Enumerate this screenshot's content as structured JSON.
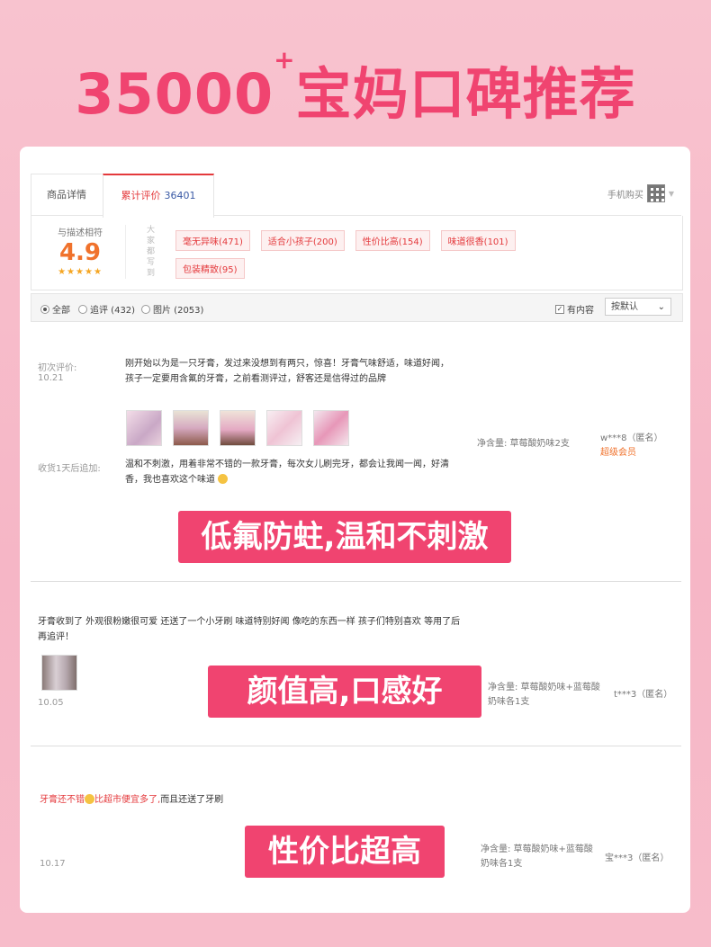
{
  "headline": {
    "number": "35000",
    "plus": "+",
    "text": "宝妈口碑推荐"
  },
  "tabs": {
    "detail": "商品详情",
    "reviews_label": "累计评价",
    "reviews_count": "36401",
    "mobile_buy": "手机购买"
  },
  "summary": {
    "score_label": "与描述相符",
    "score": "4.9",
    "stars": "★★★★★",
    "side_label": "大家都写到",
    "tags": [
      "毫无异味(471)",
      "适合小孩子(200)",
      "性价比高(154)",
      "味道很香(101)",
      "包装精致(95)"
    ]
  },
  "filter": {
    "all": "全部",
    "followup": "追评 (432)",
    "pictures": "图片 (2053)",
    "has_content": "有内容",
    "sort": "按默认"
  },
  "reviews": [
    {
      "first_label": "初次评价:",
      "date": "10.21",
      "text": "刚开始以为是一只牙膏，发过来没想到有两只，惊喜！牙膏气味舒适，味道好闻，孩子一定要用含氟的牙膏，之前看测评过，舒客还是信得过的品牌",
      "followup_label": "收货1天后追加:",
      "followup_text": "温和不刺激，用着非常不错的一款牙膏，每次女儿刷完牙，都会让我闻一闻，好清香，我也喜欢这个味道",
      "spec": "净含量: 草莓酸奶味2支",
      "user": "w***8（匿名）",
      "vip": "超级会员",
      "banner": "低氟防蛀,温和不刺激"
    },
    {
      "text": "牙膏收到了 外观很粉嫩很可爱 还送了一个小牙刷 味道特别好闻 像吃的东西一样 孩子们特别喜欢 等用了后再追评！",
      "date": "10.05",
      "spec": "净含量: 草莓酸奶味+蓝莓酸奶味各1支",
      "user": "t***3（匿名）",
      "banner": "颜值高,口感好"
    },
    {
      "text_red": "牙膏还不错",
      "text_red2": "比超市便宜多了,",
      "text_rest": "而且还送了牙刷",
      "date": "10.17",
      "spec": "净含量: 草莓酸奶味+蓝莓酸奶味各1支",
      "user": "宝***3（匿名）",
      "banner": "性价比超高"
    }
  ],
  "colors": {
    "accent": "#f04470",
    "page_bg": "#f7bcca",
    "tag_red": "#e4393c"
  }
}
